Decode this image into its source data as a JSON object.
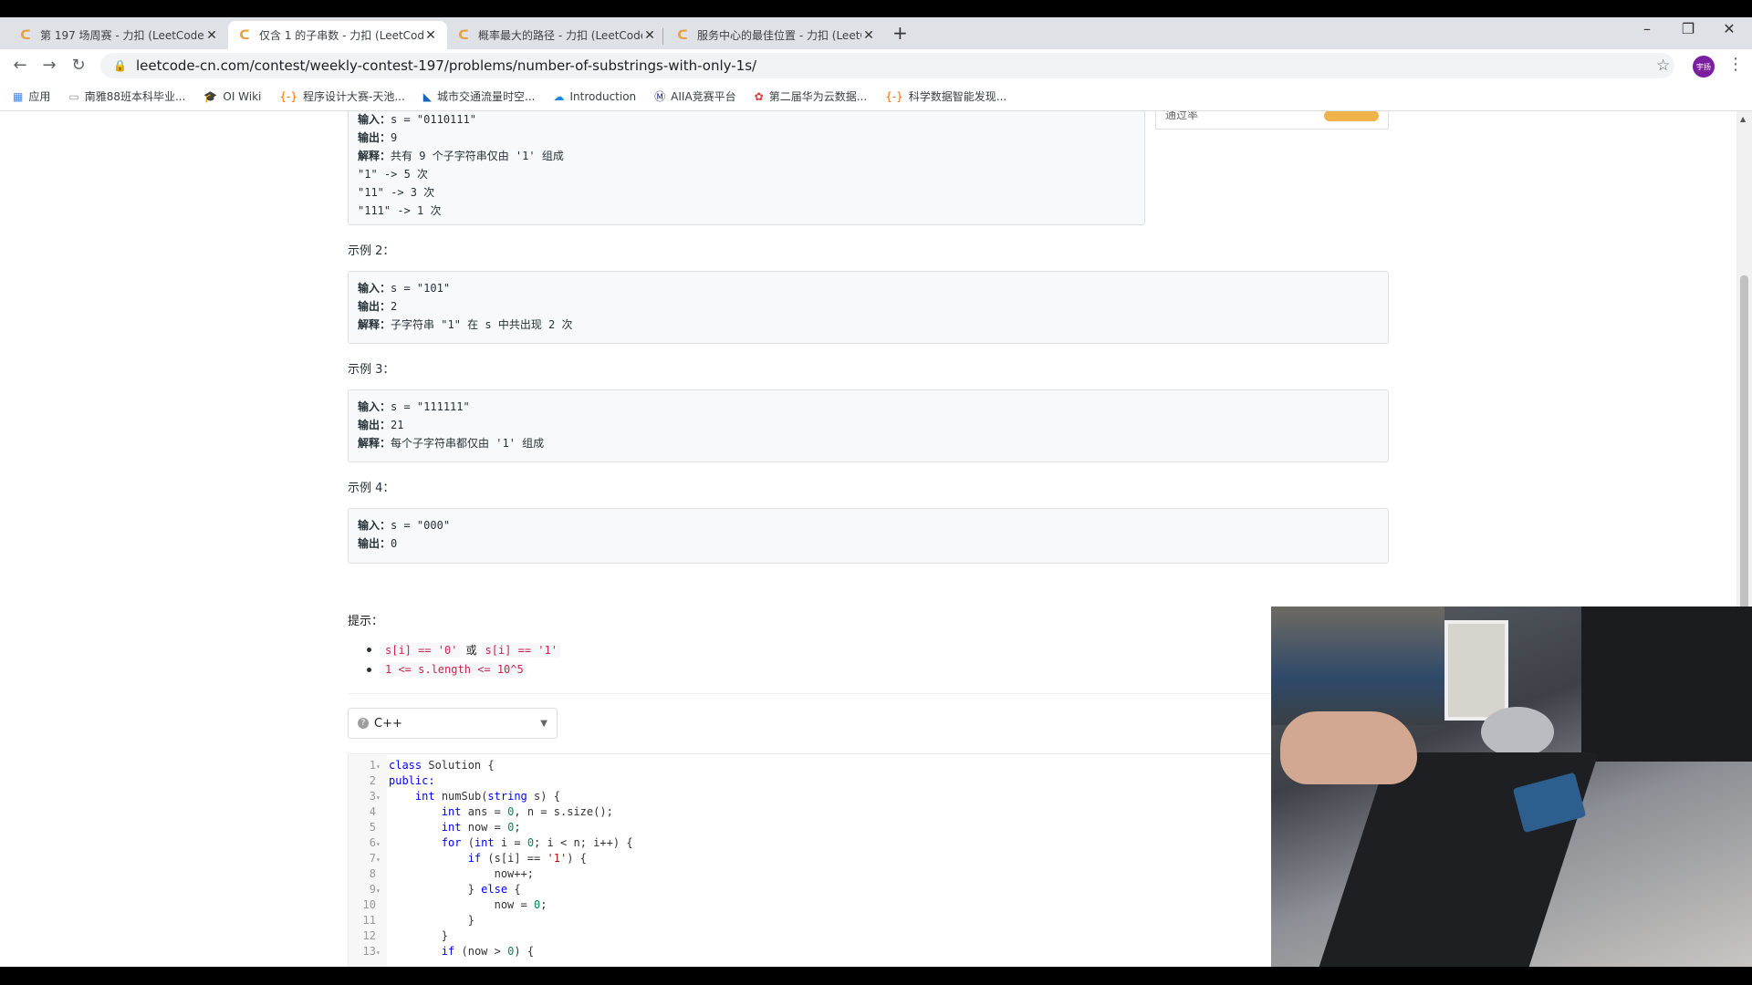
{
  "tabs": [
    {
      "title": "第 197 场周赛 - 力扣 (LeetCode)",
      "active": false
    },
    {
      "title": "仅含 1 的子串数 - 力扣 (LeetCode)",
      "active": true
    },
    {
      "title": "概率最大的路径 - 力扣 (LeetCode)",
      "active": false
    },
    {
      "title": "服务中心的最佳位置 - 力扣 (LeetCode)",
      "active": false
    }
  ],
  "new_tab_label": "+",
  "window": {
    "minimize": "–",
    "restore": "❐",
    "close": "✕"
  },
  "address": {
    "url": "leetcode-cn.com/contest/weekly-contest-197/problems/number-of-substrings-with-only-1s/"
  },
  "avatar_text": "宇扬",
  "bookmarks": [
    {
      "label": "应用",
      "icon": "apps-grid-icon"
    },
    {
      "label": "南雅88班本科毕业...",
      "icon": "folder-icon"
    },
    {
      "label": "OI Wiki",
      "icon": "graduation-cap-icon"
    },
    {
      "label": "程序设计大赛-天池...",
      "icon": "aliyun-icon"
    },
    {
      "label": "城市交通流量时空...",
      "icon": "datafountain-icon"
    },
    {
      "label": "Introduction",
      "icon": "cloud-icon"
    },
    {
      "label": "AIIA竞赛平台",
      "icon": "aiia-icon"
    },
    {
      "label": "第二届华为云数据...",
      "icon": "huawei-icon"
    },
    {
      "label": "科学数据智能发现...",
      "icon": "aliyun-icon"
    }
  ],
  "example1": {
    "input_label": "输入：",
    "input_value": "s = \"0110111\"",
    "output_label": "输出：",
    "output_value": "9",
    "explain_label": "解释：",
    "explain_value": "共有 9 个子字符串仅由 '1' 组成",
    "extra_lines": [
      "\"1\" -> 5 次",
      "\"11\" -> 3 次",
      "\"111\" -> 1 次"
    ]
  },
  "side_card_label": "通过率",
  "example2": {
    "heading": "示例 2：",
    "input_label": "输入：",
    "input_value": "s = \"101\"",
    "output_label": "输出：",
    "output_value": "2",
    "explain_label": "解释：",
    "explain_value": "子字符串 \"1\" 在 s 中共出现 2 次"
  },
  "example3": {
    "heading": "示例 3：",
    "input_label": "输入：",
    "input_value": "s = \"111111\"",
    "output_label": "输出：",
    "output_value": "21",
    "explain_label": "解释：",
    "explain_value": "每个子字符串都仅由 '1' 组成"
  },
  "example4": {
    "heading": "示例 4：",
    "input_label": "输入：",
    "input_value": "s = \"000\"",
    "output_label": "输出：",
    "output_value": "0"
  },
  "hints": {
    "heading": "提示：",
    "items": [
      {
        "a": "s[i] == '0'",
        "sep": "或",
        "b": "s[i] == '1'"
      },
      {
        "a": "1 <= s.length <= 10^5",
        "sep": "",
        "b": ""
      }
    ]
  },
  "language": {
    "selected": "C++"
  },
  "code": [
    {
      "n": "1",
      "fold": true,
      "text": "class Solution {"
    },
    {
      "n": "2",
      "fold": false,
      "text": "public:"
    },
    {
      "n": "3",
      "fold": true,
      "text": "    int numSub(string s) {"
    },
    {
      "n": "4",
      "fold": false,
      "text": "        int ans = 0, n = s.size();"
    },
    {
      "n": "5",
      "fold": false,
      "text": "        int now = 0;"
    },
    {
      "n": "6",
      "fold": true,
      "text": "        for (int i = 0; i < n; i++) {"
    },
    {
      "n": "7",
      "fold": true,
      "text": "            if (s[i] == '1') {"
    },
    {
      "n": "8",
      "fold": false,
      "text": "                now++;"
    },
    {
      "n": "9",
      "fold": true,
      "text": "            } else {"
    },
    {
      "n": "10",
      "fold": false,
      "text": "                now = 0;"
    },
    {
      "n": "11",
      "fold": false,
      "text": "            }"
    },
    {
      "n": "12",
      "fold": false,
      "text": "        }"
    },
    {
      "n": "13",
      "fold": true,
      "text": "        if (now > 0) {"
    }
  ],
  "colors": {
    "accent": "#f0b34a",
    "code_keyword": "#0000ff",
    "hint_code": "#c7254e"
  }
}
